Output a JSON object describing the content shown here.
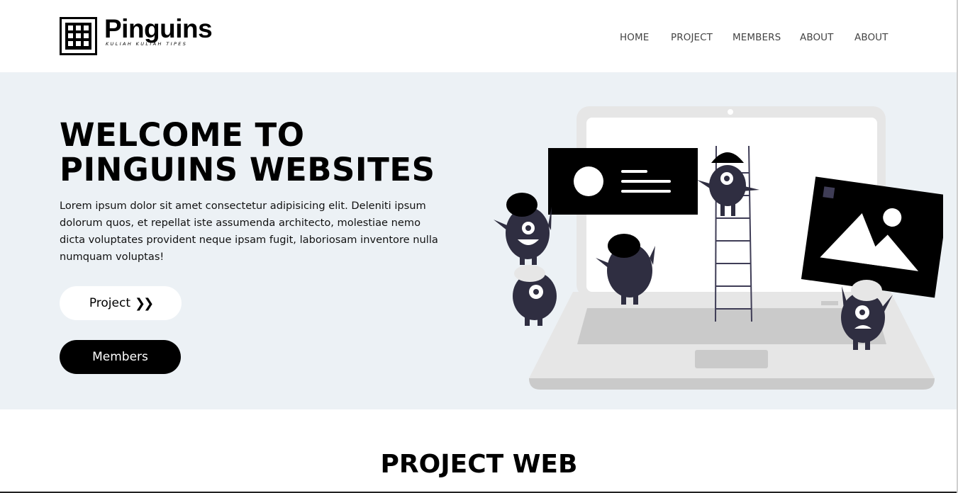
{
  "brand": {
    "name": "Pinguins",
    "tagline": "KULIAH KULIAH TIPES"
  },
  "nav": {
    "items": [
      {
        "label": "HOME"
      },
      {
        "label": "PROJECT"
      },
      {
        "label": "MEMBERS"
      },
      {
        "label": "ABOUT"
      },
      {
        "label": "ABOUT"
      }
    ]
  },
  "hero": {
    "title_line1": "WELCOME TO",
    "title_line2": "PINGUINS WEBSITES",
    "text": "Lorem ipsum dolor sit amet consectetur adipisicing elit. Deleniti ipsum dolorum quos, et repellat iste assumenda architecto, molestiae nemo dicta voluptates provident neque ipsam fugit, laboriosam inventore nulla numquam voluptas!",
    "project_button": "Project",
    "members_button": "Members",
    "illustration": "people-building-website-on-laptop-illustration"
  },
  "section": {
    "title": "PROJECT WEB"
  },
  "colors": {
    "hero_bg": "#ecf1f5",
    "primary": "#000000",
    "character": "#2f2e41",
    "laptop": "#e6e6e6"
  }
}
